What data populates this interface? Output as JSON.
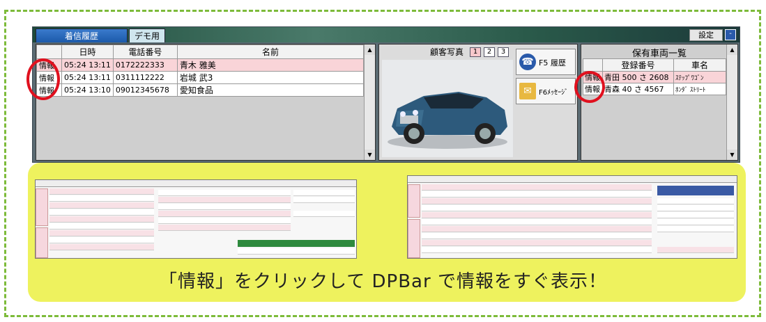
{
  "window": {
    "tabs": [
      "着信履歴",
      "デモ用"
    ],
    "settings_label": "設定",
    "minimize_label": "-"
  },
  "call_history": {
    "headers": [
      "",
      "日時",
      "電話番号",
      "名前"
    ],
    "rows": [
      {
        "info": "情報",
        "datetime": "05:24 13:11",
        "phone": "0172222333",
        "name": "青木 雅美",
        "selected": true
      },
      {
        "info": "情報",
        "datetime": "05:24 13:11",
        "phone": "0311112222",
        "name": "岩城 武3",
        "selected": false
      },
      {
        "info": "情報",
        "datetime": "05:24 13:10",
        "phone": "09012345678",
        "name": "愛知食品",
        "selected": false
      }
    ]
  },
  "customer_photo": {
    "title": "顧客写真",
    "pages": [
      "1",
      "2",
      "3"
    ],
    "active_page": "1",
    "f5_label": "F5 履歴",
    "f6_label": "F6ﾒｯｾｰｼﾞ"
  },
  "vehicles": {
    "title": "保有車両一覧",
    "headers": [
      "",
      "登録番号",
      "車名"
    ],
    "rows": [
      {
        "info": "情報",
        "reg": "青田 500 さ 2608",
        "name": "ｽﾃｯﾌﾟﾜｺﾞﾝ",
        "selected": true
      },
      {
        "info": "情報",
        "reg": "青森 40 さ 4567",
        "name": "ﾎﾝﾀﾞ ｽﾄﾘｰﾄ",
        "selected": false
      }
    ]
  },
  "caption": "「情報」をクリックして DPBar で情報をすぐ表示！",
  "colors": {
    "accent_green": "#7dbb3a",
    "highlight_yellow": "#eef25e",
    "selected_row": "#f9d4d8",
    "ring_red": "#e0101e"
  }
}
